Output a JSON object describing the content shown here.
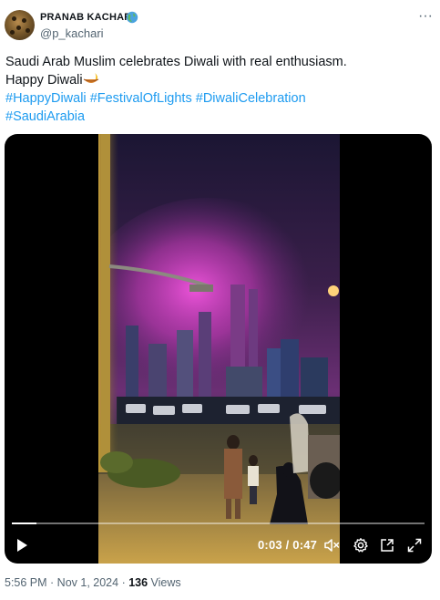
{
  "author": {
    "display_name": "PRANAB KACHARI",
    "handle": "@p_kachari",
    "badge_icon": "globe-icon"
  },
  "tweet": {
    "line1": "Saudi Arab Muslim celebrates Diwali with real enthusiasm.",
    "line2": "Happy Diwali",
    "hashtags_line1": [
      "#HappyDiwali",
      "#FestivalOfLights",
      "#DiwaliCelebration"
    ],
    "hashtags_line2": [
      "#SaudiArabia"
    ]
  },
  "video": {
    "current_time": "0:03",
    "separator": " / ",
    "duration": "0:47",
    "progress_fraction": 0.06
  },
  "meta": {
    "time": "5:56 PM",
    "dot1": " · ",
    "date": "Nov 1, 2024",
    "dot2": " · ",
    "views": "136",
    "views_label": " Views"
  },
  "colors": {
    "link": "#1d9bf0",
    "text": "#0f1419",
    "secondary": "#536471"
  }
}
